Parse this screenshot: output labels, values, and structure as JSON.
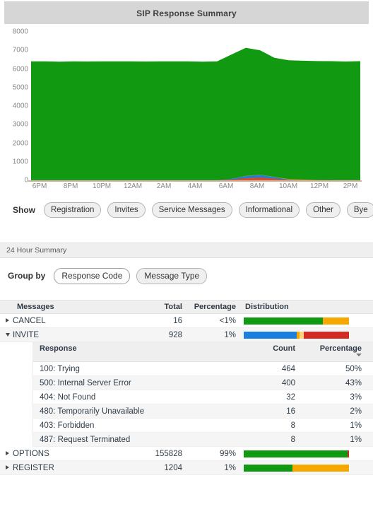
{
  "panel": {
    "title": "SIP Response Summary"
  },
  "chart_data": {
    "type": "area",
    "title": "SIP Response Summary",
    "xlabel": "",
    "ylabel": "",
    "ylim": [
      0,
      8000
    ],
    "y_ticks": [
      "0",
      "1000",
      "2000",
      "3000",
      "4000",
      "5000",
      "6000",
      "7000",
      "8000"
    ],
    "x_ticks": [
      "6PM",
      "8PM",
      "10PM",
      "12AM",
      "2AM",
      "4AM",
      "6AM",
      "8AM",
      "10AM",
      "12PM",
      "2PM"
    ],
    "grid": false,
    "legend_position": "below",
    "stacked": true,
    "x": [
      0,
      1,
      2,
      3,
      4,
      5,
      6,
      7,
      8,
      9,
      10,
      11,
      12,
      13,
      14,
      15,
      16,
      17,
      18,
      19,
      20,
      21,
      22,
      23
    ],
    "series": [
      {
        "name": "Other",
        "color": "#d94b2b",
        "values": [
          5,
          5,
          5,
          5,
          5,
          5,
          5,
          5,
          5,
          5,
          5,
          5,
          5,
          5,
          40,
          120,
          150,
          90,
          20,
          10,
          8,
          8,
          8,
          8
        ]
      },
      {
        "name": "Informational",
        "color": "#1b7fe0",
        "values": [
          3,
          3,
          3,
          3,
          3,
          3,
          3,
          3,
          3,
          3,
          3,
          3,
          3,
          3,
          30,
          110,
          140,
          80,
          18,
          6,
          5,
          5,
          5,
          5
        ]
      },
      {
        "name": "Service Messages",
        "color": "#f6a800",
        "values": [
          4,
          4,
          4,
          4,
          4,
          4,
          4,
          4,
          4,
          4,
          4,
          4,
          4,
          4,
          6,
          10,
          14,
          12,
          30,
          28,
          10,
          6,
          5,
          5
        ]
      },
      {
        "name": "Registration",
        "color": "#119911",
        "values": [
          6400,
          6400,
          6380,
          6400,
          6390,
          6400,
          6400,
          6400,
          6390,
          6400,
          6400,
          6400,
          6380,
          6400,
          6700,
          6900,
          6700,
          6420,
          6400,
          6400,
          6400,
          6400,
          6380,
          6400
        ]
      }
    ]
  },
  "show": {
    "label": "Show",
    "buttons": [
      {
        "label": "Registration",
        "selected": false
      },
      {
        "label": "Invites",
        "selected": false
      },
      {
        "label": "Service Messages",
        "selected": false
      },
      {
        "label": "Informational",
        "selected": false
      },
      {
        "label": "Other",
        "selected": false
      },
      {
        "label": "Bye",
        "selected": false
      }
    ]
  },
  "summary_section": {
    "title": "24 Hour Summary"
  },
  "group_by": {
    "label": "Group by",
    "options": [
      {
        "label": "Response Code",
        "selected": true
      },
      {
        "label": "Message Type",
        "selected": false
      }
    ]
  },
  "table": {
    "headers": {
      "messages": "Messages",
      "total": "Total",
      "percentage": "Percentage",
      "distribution": "Distribution"
    },
    "rows": [
      {
        "name": "CANCEL",
        "total": "16",
        "percentage": "<1%",
        "expanded": false,
        "distribution": [
          {
            "color": "#119911",
            "pct": 75
          },
          {
            "color": "#f6a800",
            "pct": 25
          }
        ]
      },
      {
        "name": "INVITE",
        "total": "928",
        "percentage": "1%",
        "expanded": true,
        "distribution": [
          {
            "color": "#1b7fe0",
            "pct": 50
          },
          {
            "color": "#f6a800",
            "pct": 3
          },
          {
            "color": "#ffd27f",
            "pct": 4
          },
          {
            "color": "#d42a23",
            "pct": 43
          }
        ]
      },
      {
        "name": "OPTIONS",
        "total": "155828",
        "percentage": "99%",
        "expanded": false,
        "distribution": [
          {
            "color": "#119911",
            "pct": 98.5
          },
          {
            "color": "#d42a23",
            "pct": 1.5
          }
        ]
      },
      {
        "name": "REGISTER",
        "total": "1204",
        "percentage": "1%",
        "expanded": false,
        "distribution": [
          {
            "color": "#119911",
            "pct": 46
          },
          {
            "color": "#f6a800",
            "pct": 54
          }
        ]
      }
    ]
  },
  "subtable": {
    "headers": {
      "response": "Response",
      "count": "Count",
      "percentage": "Percentage"
    },
    "sorted_by": "percentage",
    "sort_direction": "descending",
    "rows": [
      {
        "response": "100: Trying",
        "count": "464",
        "percentage": "50%"
      },
      {
        "response": "500: Internal Server Error",
        "count": "400",
        "percentage": "43%"
      },
      {
        "response": "404: Not Found",
        "count": "32",
        "percentage": "3%"
      },
      {
        "response": "480: Temporarily Unavailable",
        "count": "16",
        "percentage": "2%"
      },
      {
        "response": "403: Forbidden",
        "count": "8",
        "percentage": "1%"
      },
      {
        "response": "487: Request Terminated",
        "count": "8",
        "percentage": "1%"
      }
    ]
  }
}
